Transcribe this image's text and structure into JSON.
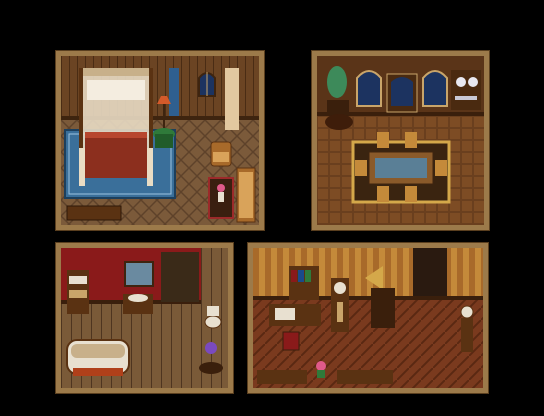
{
  "scene": {
    "background_color": "#000000",
    "rooms": [
      {
        "id": "bedroom",
        "features": [
          "canopy-bed",
          "floor-lamp",
          "side-table",
          "window",
          "curtains",
          "armchair",
          "flower-vase",
          "rug",
          "doormat"
        ]
      },
      {
        "id": "dining-room",
        "features": [
          "arched-window",
          "tea-set-shelf",
          "dining-table",
          "chairs",
          "potted-plant",
          "cabinet"
        ]
      },
      {
        "id": "bathroom",
        "features": [
          "bathtub",
          "sink",
          "mirror",
          "toilet",
          "flower-pot",
          "shelf"
        ]
      },
      {
        "id": "study",
        "features": [
          "bookshelf",
          "desk",
          "grandfather-clock",
          "gramophone",
          "pendulum-clock",
          "chair",
          "flower-pot",
          "bench"
        ]
      }
    ],
    "colors": {
      "frame": "#9c7a4a",
      "wall_wood": "#6b4423",
      "floor_parquet": "#7b5a3a",
      "rug_blue": "#3a6f9a",
      "red_wall": "#8a1a1a"
    }
  }
}
